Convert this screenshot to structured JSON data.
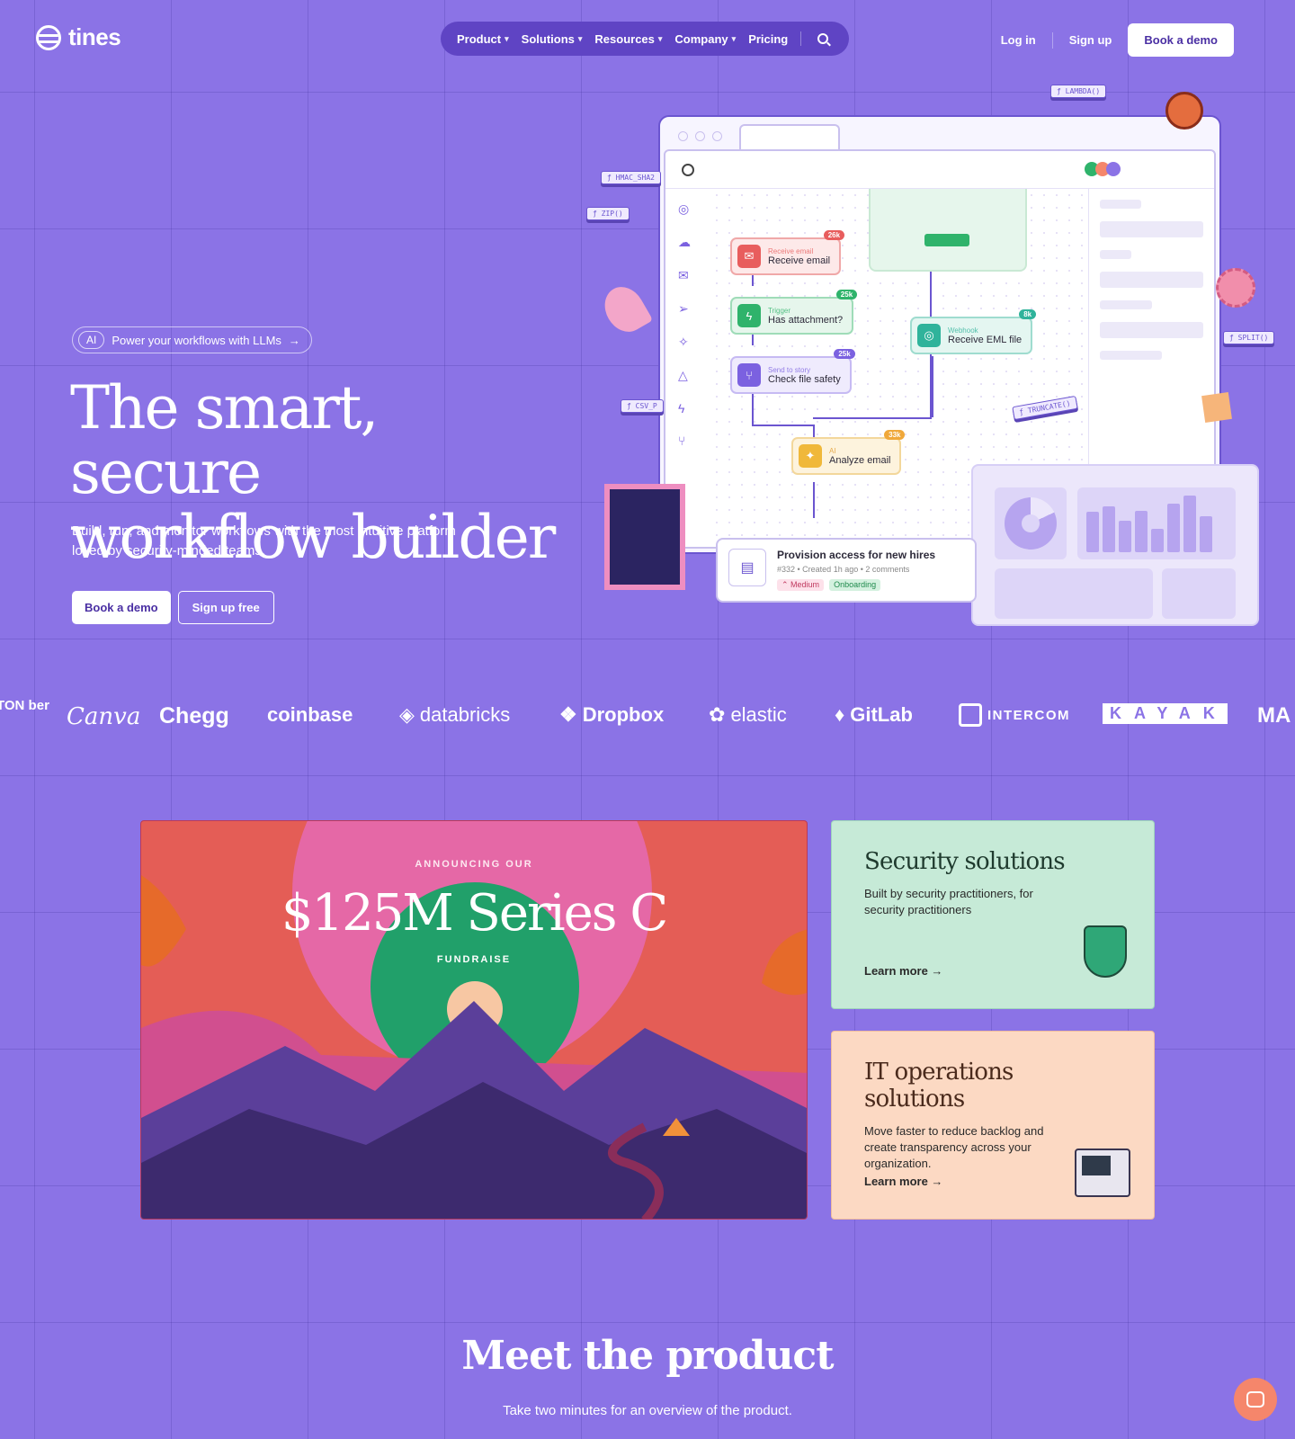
{
  "brand": {
    "name": "tines"
  },
  "nav": {
    "items": [
      {
        "label": "Product",
        "dropdown": true
      },
      {
        "label": "Solutions",
        "dropdown": true
      },
      {
        "label": "Resources",
        "dropdown": true
      },
      {
        "label": "Company",
        "dropdown": true
      },
      {
        "label": "Pricing",
        "dropdown": false
      }
    ],
    "search_icon": "search-icon",
    "login": "Log in",
    "signup": "Sign up",
    "book_demo": "Book a demo"
  },
  "hero": {
    "ai_badge": "AI",
    "pill_text": "Power your workflows with LLMs",
    "pill_arrow": "→",
    "title_line1": "The smart, secure",
    "title_line2": "workflow builder",
    "subtitle": "Build, run, and monitor workflows with the most intuitive platform loved by security-minded teams.",
    "cta_primary": "Book a demo",
    "cta_secondary": "Sign up free"
  },
  "illustration": {
    "fn_tags": [
      "ƒ LAMBDA()",
      "ƒ HMAC_SHA2",
      "ƒ ZIP()",
      "ƒ CSV_P",
      "ƒ SPLIT()",
      "ƒ TRUNCATE()"
    ],
    "nodes": [
      {
        "kind": "Receive email",
        "name": "Receive email",
        "count": "26k",
        "color": "#e85d5d"
      },
      {
        "kind": "Trigger",
        "name": "Has attachment?",
        "count": "25k",
        "color": "#2fb36b"
      },
      {
        "kind": "Send to story",
        "name": "Check file safety",
        "count": "25k",
        "color": "#7b61e0"
      },
      {
        "kind": "Webhook",
        "name": "Receive EML file",
        "count": "8k",
        "color": "#2fb39b"
      },
      {
        "kind": "AI",
        "name": "Analyze email",
        "count": "33k",
        "color": "#f0b83a"
      }
    ],
    "task": {
      "title": "Provision access for new hires",
      "meta": "#332 • Created 1h ago • 2 comments",
      "tag_priority": "⌃ Medium",
      "tag_team": "Onboarding"
    }
  },
  "logos": [
    "TON ber",
    "Canva",
    "Chegg",
    "coinbase",
    "databricks",
    "Dropbox",
    "elastic",
    "GitLab",
    "INTERCOM",
    "KAYAK",
    "MA"
  ],
  "promo": {
    "kicker": "ANNOUNCING OUR",
    "title": "$125M Series C",
    "sub": "FUNDRAISE"
  },
  "solutions": [
    {
      "title": "Security solutions",
      "desc": "Built by security practitioners, for security practitioners",
      "link": "Learn more →",
      "icon": "shield-icon"
    },
    {
      "title": "IT operations solutions",
      "desc": "Move faster to reduce backlog and create transparency across your organization.",
      "link": "Learn more →",
      "icon": "computer-icon"
    }
  ],
  "meet": {
    "title": "Meet the product",
    "subtitle": "Take two minutes for an overview of the product."
  },
  "chat": {
    "icon": "chat-icon"
  }
}
